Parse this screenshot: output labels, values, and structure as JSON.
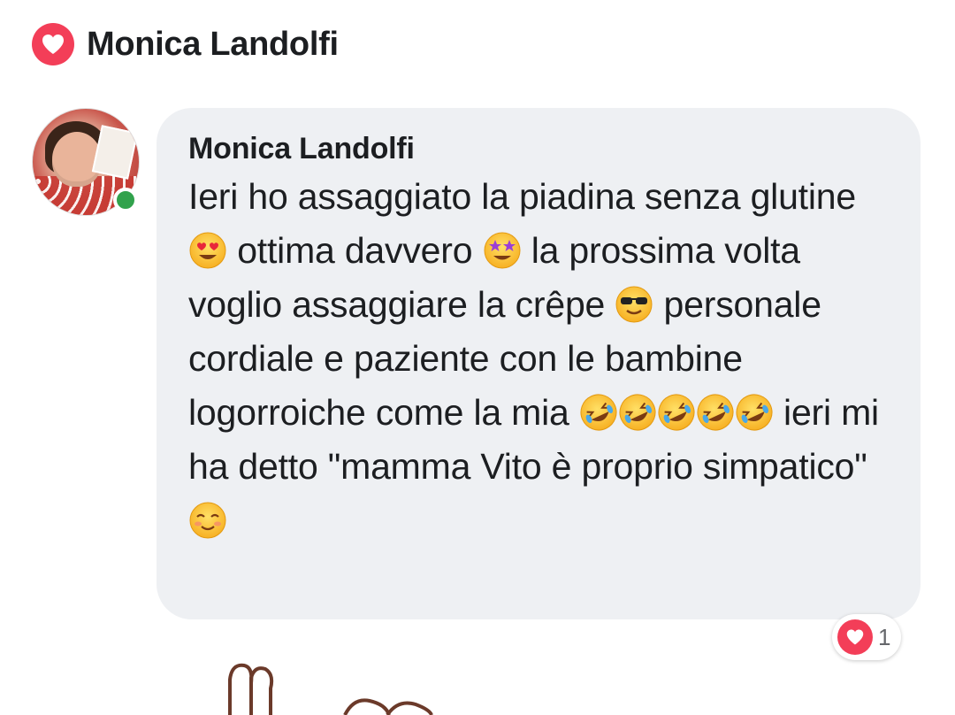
{
  "header": {
    "name": "Monica Landolfi",
    "reaction_icon": "heart-icon",
    "reaction_color": "#f33e58"
  },
  "comment": {
    "author": "Monica Landolfi",
    "online": true,
    "segments": {
      "s1": "Ieri ho assaggiato la piadina senza glutine ",
      "s2": " ottima davvero ",
      "s3": " la prossima volta voglio assaggiare la crêpe ",
      "s4": " personale cordiale e paziente con le bambine logorroiche come la mia ",
      "s5": " ieri mi ha detto \"mamma Vito è proprio simpatico\" "
    },
    "emojis": [
      "heart-eyes-emoji",
      "star-struck-emoji",
      "sunglasses-emoji",
      "rolling-laughing-emoji",
      "rolling-laughing-emoji",
      "rolling-laughing-emoji",
      "rolling-laughing-emoji",
      "rolling-laughing-emoji",
      "smiling-blush-emoji"
    ]
  },
  "reactions": {
    "icon": "heart-icon",
    "count": "1"
  },
  "colors": {
    "bubble": "#eef0f3",
    "online": "#31a24c",
    "heart": "#f33e58"
  }
}
